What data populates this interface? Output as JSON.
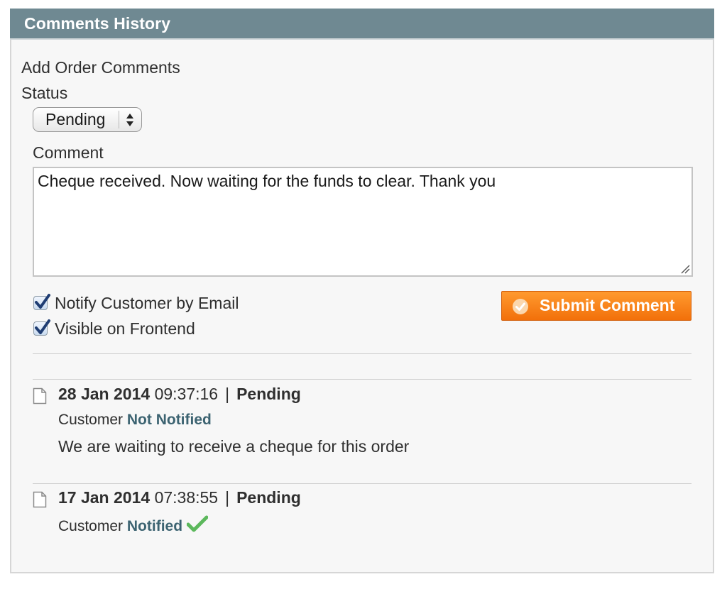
{
  "panel": {
    "title": "Comments History"
  },
  "form": {
    "heading": "Add Order Comments",
    "status_label": "Status",
    "status_value": "Pending",
    "comment_label": "Comment",
    "comment_value": "Cheque received. Now waiting for the funds to clear. Thank you",
    "notify_label": "Notify Customer by Email",
    "notify_checked": true,
    "visible_label": "Visible on Frontend",
    "visible_checked": true,
    "submit_label": "Submit Comment"
  },
  "history": [
    {
      "date": "28 Jan 2014",
      "time": "09:37:16",
      "separator": "|",
      "status": "Pending",
      "customer_label": "Customer",
      "notify_state": "Not Notified",
      "comment": "We are waiting to receive a cheque for this order"
    },
    {
      "date": "17 Jan 2014",
      "time": "07:38:55",
      "separator": "|",
      "status": "Pending",
      "customer_label": "Customer",
      "notify_state": "Notified",
      "comment": ""
    }
  ],
  "icons": {
    "select_arrows": "updown-arrows-icon",
    "checkbox": "checkmark-icon",
    "submit": "check-circle-icon",
    "entry": "document-icon",
    "notified": "green-check-icon"
  },
  "colors": {
    "header_bg": "#6f8992",
    "submit_bg": "#f58220",
    "link_teal": "#3c6371",
    "check_green": "#5cb85c"
  }
}
